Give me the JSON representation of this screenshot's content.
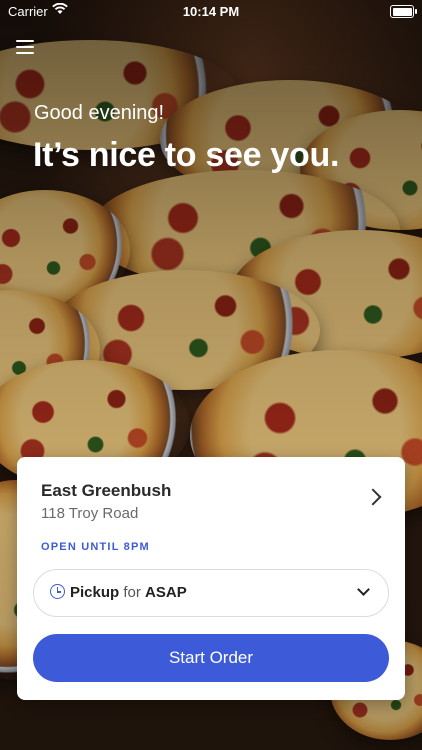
{
  "status_bar": {
    "carrier": "Carrier",
    "time": "10:14 PM"
  },
  "hero": {
    "greeting": "Good evening!",
    "headline": "It’s nice to see you."
  },
  "store": {
    "name": "East Greenbush",
    "address": "118 Troy Road",
    "hours": "OPEN UNTIL 8PM"
  },
  "order_mode": {
    "mode": "Pickup",
    "connector": "for",
    "time": "ASAP"
  },
  "actions": {
    "start_order": "Start Order"
  },
  "colors": {
    "accent": "#3d5ad8"
  }
}
